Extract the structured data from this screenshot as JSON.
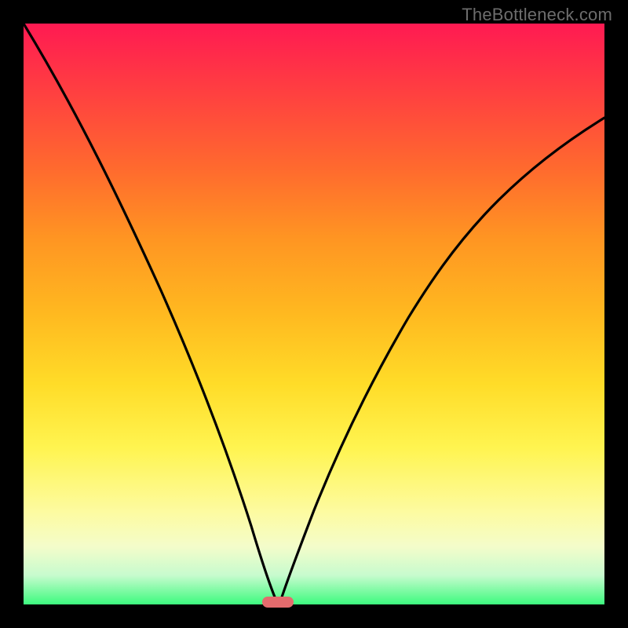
{
  "watermark": "TheBottleneck.com",
  "chart_data": {
    "type": "line",
    "title": "",
    "xlabel": "",
    "ylabel": "",
    "xlim": [
      0,
      100
    ],
    "ylim": [
      0,
      100
    ],
    "grid": false,
    "series": [
      {
        "name": "curve",
        "x": [
          0,
          5,
          10,
          15,
          20,
          25,
          30,
          35,
          40,
          43.8,
          44,
          44.5,
          48,
          52,
          58,
          65,
          72,
          80,
          88,
          95,
          100
        ],
        "values": [
          100,
          87,
          75,
          64,
          53,
          42,
          31,
          20,
          8,
          0,
          0,
          0.5,
          8,
          16,
          28,
          40,
          51,
          62,
          72,
          79,
          84
        ]
      }
    ],
    "marker": {
      "x": 43.8,
      "y": 0
    },
    "gradient_colors_top_to_bottom": [
      "#ff1a52",
      "#ff4040",
      "#ff6a2e",
      "#ff9522",
      "#ffb920",
      "#ffdc28",
      "#fff450",
      "#fdfba0",
      "#f4fcca",
      "#c7fbce",
      "#3dfa7e"
    ]
  }
}
